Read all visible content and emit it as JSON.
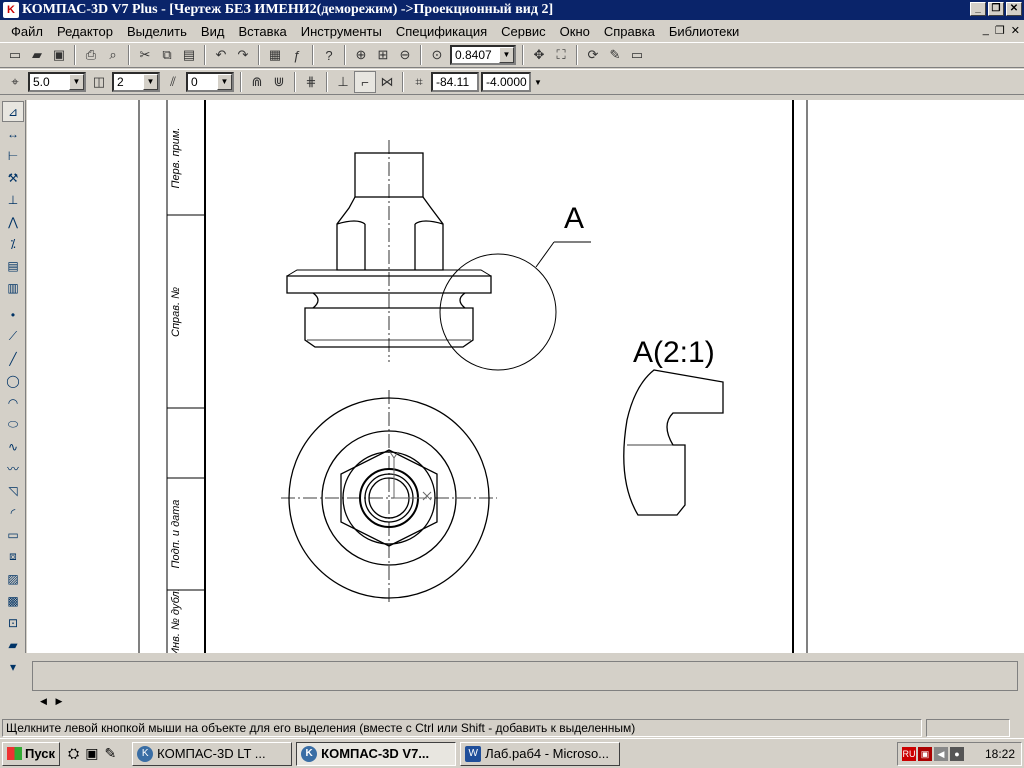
{
  "titlebar": {
    "title": "КОМПАС-3D V7 Plus - [Чертеж БЕЗ ИМЕНИ2(деморежим) ->Проекционный вид 2]",
    "minimize": "_",
    "restore": "❐",
    "close": "✕"
  },
  "menu": {
    "items": [
      {
        "label": "Файл"
      },
      {
        "label": "Редактор"
      },
      {
        "label": "Выделить"
      },
      {
        "label": "Вид"
      },
      {
        "label": "Вставка"
      },
      {
        "label": "Инструменты"
      },
      {
        "label": "Спецификация"
      },
      {
        "label": "Сервис"
      },
      {
        "label": "Окно"
      },
      {
        "label": "Справка"
      },
      {
        "label": "Библиотеки"
      }
    ]
  },
  "toolbar": {
    "zoom_value": "0.8407"
  },
  "props": {
    "step_value": "5.0",
    "layer_value": "2",
    "view_value": "0",
    "coord_x": "-84.11",
    "coord_y": "-4.0000"
  },
  "drawing": {
    "callout_label": "A",
    "detail_label": "A(2:1)",
    "stamp_texts": [
      "Перв. прим.",
      "Справ. №",
      "Подп. и дата",
      "Инв. № дубл."
    ]
  },
  "status": {
    "text": "Щелкните левой кнопкой мыши на объекте для его выделения (вместе с Ctrl или Shift - добавить к выделенным)"
  },
  "taskbar": {
    "start_label": "Пуск",
    "tasks": [
      {
        "label": "КОМПАС-3D LT ..."
      },
      {
        "label": "КОМПАС-3D V7..."
      },
      {
        "label": "Лаб.раб4 - Microso..."
      }
    ],
    "clock": "18:22"
  }
}
